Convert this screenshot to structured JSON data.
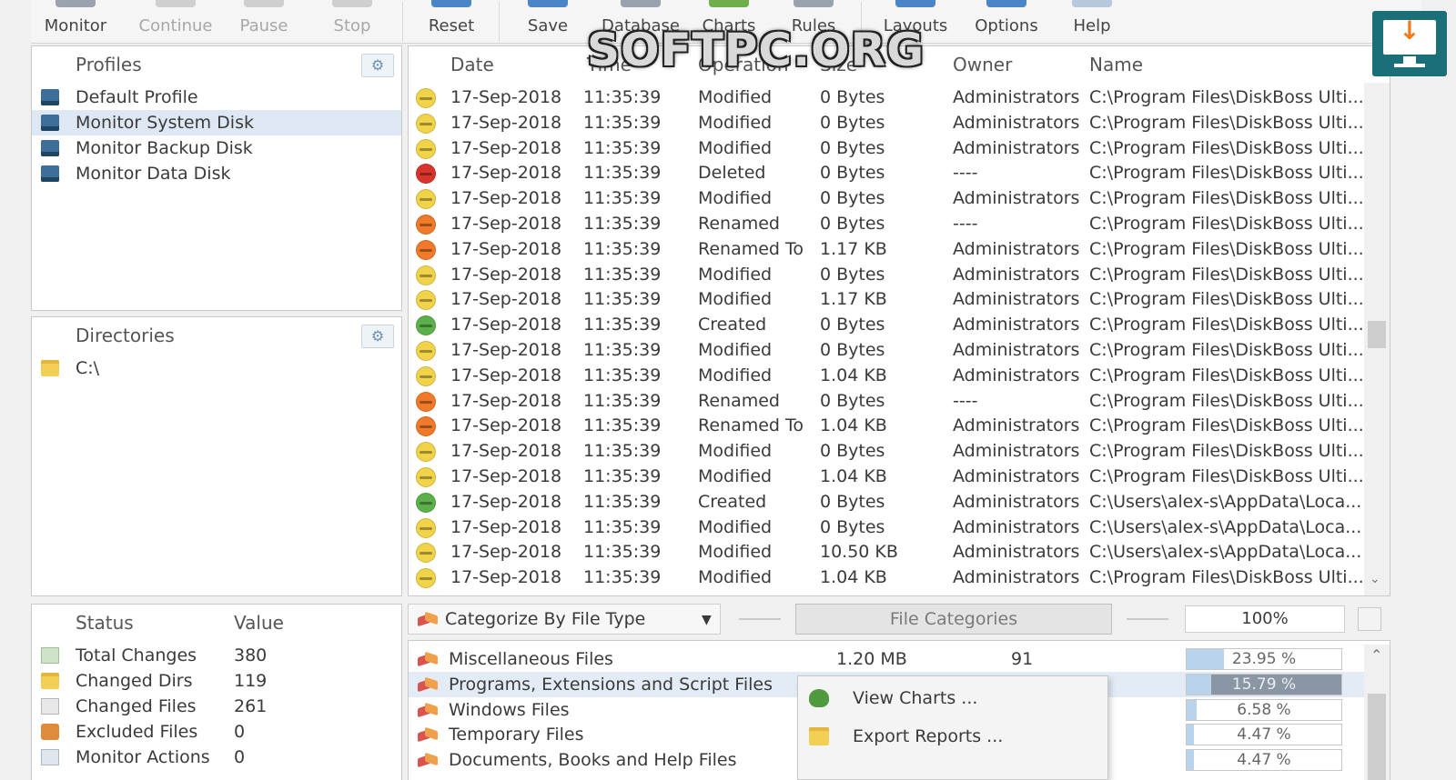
{
  "toolbar": {
    "buttons": [
      {
        "label": "Monitor",
        "enabled": true
      },
      {
        "label": "Continue",
        "enabled": false
      },
      {
        "label": "Pause",
        "enabled": false
      },
      {
        "label": "Stop",
        "enabled": false
      },
      {
        "label": "Reset",
        "enabled": true
      },
      {
        "label": "Save",
        "enabled": true
      },
      {
        "label": "Database",
        "enabled": true
      },
      {
        "label": "Charts",
        "enabled": true
      },
      {
        "label": "Rules",
        "enabled": true
      },
      {
        "label": "Layouts",
        "enabled": true
      },
      {
        "label": "Options",
        "enabled": true
      },
      {
        "label": "Help",
        "enabled": true
      }
    ]
  },
  "watermark": "SOFTPC.ORG",
  "profiles": {
    "header": "Profiles",
    "items": [
      {
        "label": "Default Profile",
        "selected": false
      },
      {
        "label": "Monitor System Disk",
        "selected": true
      },
      {
        "label": "Monitor Backup Disk",
        "selected": false
      },
      {
        "label": "Monitor Data Disk",
        "selected": false
      }
    ]
  },
  "directories": {
    "header": "Directories",
    "items": [
      {
        "label": "C:\\"
      }
    ]
  },
  "status": {
    "headers": {
      "status": "Status",
      "value": "Value"
    },
    "rows": [
      {
        "label": "Total Changes",
        "value": "380"
      },
      {
        "label": "Changed Dirs",
        "value": "119"
      },
      {
        "label": "Changed Files",
        "value": "261"
      },
      {
        "label": "Excluded Files",
        "value": "0"
      },
      {
        "label": "Monitor Actions",
        "value": "0"
      }
    ]
  },
  "events": {
    "headers": {
      "date": "Date",
      "time": "Time",
      "operation": "Operation",
      "size": "Size",
      "owner": "Owner",
      "name": "Name"
    },
    "status_colors": {
      "Modified": "#f1d34a",
      "Deleted": "#d9342b",
      "Renamed": "#f07a2a",
      "Renamed To": "#f07a2a",
      "Created": "#5cb04b"
    },
    "rows": [
      {
        "date": "17-Sep-2018",
        "time": "11:35:39",
        "operation": "Modified",
        "size": "0 Bytes",
        "owner": "Administrators",
        "name": "C:\\Program Files\\DiskBoss Ulti..."
      },
      {
        "date": "17-Sep-2018",
        "time": "11:35:39",
        "operation": "Modified",
        "size": "0 Bytes",
        "owner": "Administrators",
        "name": "C:\\Program Files\\DiskBoss Ulti..."
      },
      {
        "date": "17-Sep-2018",
        "time": "11:35:39",
        "operation": "Modified",
        "size": "0 Bytes",
        "owner": "Administrators",
        "name": "C:\\Program Files\\DiskBoss Ulti..."
      },
      {
        "date": "17-Sep-2018",
        "time": "11:35:39",
        "operation": "Deleted",
        "size": "0 Bytes",
        "owner": "----",
        "name": "C:\\Program Files\\DiskBoss Ulti..."
      },
      {
        "date": "17-Sep-2018",
        "time": "11:35:39",
        "operation": "Modified",
        "size": "0 Bytes",
        "owner": "Administrators",
        "name": "C:\\Program Files\\DiskBoss Ulti..."
      },
      {
        "date": "17-Sep-2018",
        "time": "11:35:39",
        "operation": "Renamed",
        "size": "0 Bytes",
        "owner": "----",
        "name": "C:\\Program Files\\DiskBoss Ulti..."
      },
      {
        "date": "17-Sep-2018",
        "time": "11:35:39",
        "operation": "Renamed To",
        "size": "1.17 KB",
        "owner": "Administrators",
        "name": "C:\\Program Files\\DiskBoss Ulti..."
      },
      {
        "date": "17-Sep-2018",
        "time": "11:35:39",
        "operation": "Modified",
        "size": "0 Bytes",
        "owner": "Administrators",
        "name": "C:\\Program Files\\DiskBoss Ulti..."
      },
      {
        "date": "17-Sep-2018",
        "time": "11:35:39",
        "operation": "Modified",
        "size": "1.17 KB",
        "owner": "Administrators",
        "name": "C:\\Program Files\\DiskBoss Ulti..."
      },
      {
        "date": "17-Sep-2018",
        "time": "11:35:39",
        "operation": "Created",
        "size": "0 Bytes",
        "owner": "Administrators",
        "name": "C:\\Program Files\\DiskBoss Ulti..."
      },
      {
        "date": "17-Sep-2018",
        "time": "11:35:39",
        "operation": "Modified",
        "size": "0 Bytes",
        "owner": "Administrators",
        "name": "C:\\Program Files\\DiskBoss Ulti..."
      },
      {
        "date": "17-Sep-2018",
        "time": "11:35:39",
        "operation": "Modified",
        "size": "1.04 KB",
        "owner": "Administrators",
        "name": "C:\\Program Files\\DiskBoss Ulti..."
      },
      {
        "date": "17-Sep-2018",
        "time": "11:35:39",
        "operation": "Renamed",
        "size": "0 Bytes",
        "owner": "----",
        "name": "C:\\Program Files\\DiskBoss Ulti..."
      },
      {
        "date": "17-Sep-2018",
        "time": "11:35:39",
        "operation": "Renamed To",
        "size": "1.04 KB",
        "owner": "Administrators",
        "name": "C:\\Program Files\\DiskBoss Ulti..."
      },
      {
        "date": "17-Sep-2018",
        "time": "11:35:39",
        "operation": "Modified",
        "size": "0 Bytes",
        "owner": "Administrators",
        "name": "C:\\Program Files\\DiskBoss Ulti..."
      },
      {
        "date": "17-Sep-2018",
        "time": "11:35:39",
        "operation": "Modified",
        "size": "1.04 KB",
        "owner": "Administrators",
        "name": "C:\\Program Files\\DiskBoss Ulti..."
      },
      {
        "date": "17-Sep-2018",
        "time": "11:35:39",
        "operation": "Created",
        "size": "0 Bytes",
        "owner": "Administrators",
        "name": "C:\\Users\\alex-s\\AppData\\Loca..."
      },
      {
        "date": "17-Sep-2018",
        "time": "11:35:39",
        "operation": "Modified",
        "size": "0 Bytes",
        "owner": "Administrators",
        "name": "C:\\Users\\alex-s\\AppData\\Loca..."
      },
      {
        "date": "17-Sep-2018",
        "time": "11:35:39",
        "operation": "Modified",
        "size": "10.50 KB",
        "owner": "Administrators",
        "name": "C:\\Users\\alex-s\\AppData\\Loca..."
      },
      {
        "date": "17-Sep-2018",
        "time": "11:35:39",
        "operation": "Modified",
        "size": "1.04 KB",
        "owner": "Administrators",
        "name": "C:\\Program Files\\DiskBoss Ulti..."
      }
    ]
  },
  "categories": {
    "select_label": "Categorize By File Type",
    "button_label": "File Categories",
    "zoom": "100%",
    "rows": [
      {
        "label": "Miscellaneous Files",
        "size": "1.20 MB",
        "count": "91",
        "percent": "23.95 %",
        "fraction": 0.2395,
        "selected": false
      },
      {
        "label": "Programs, Extensions and Script Files",
        "size": "",
        "count": "",
        "percent": "15.79 %",
        "fraction": 0.1579,
        "selected": true
      },
      {
        "label": "Windows Files",
        "size": "",
        "count": "",
        "percent": "6.58 %",
        "fraction": 0.0658,
        "selected": false
      },
      {
        "label": "Temporary Files",
        "size": "",
        "count": "",
        "percent": "4.47 %",
        "fraction": 0.0447,
        "selected": false
      },
      {
        "label": "Documents, Books and Help Files",
        "size": "",
        "count": "",
        "percent": "4.47 %",
        "fraction": 0.0447,
        "selected": false
      }
    ]
  },
  "context_menu": {
    "items": [
      {
        "label": "View Charts ..."
      },
      {
        "label": "Export Reports ..."
      }
    ]
  }
}
